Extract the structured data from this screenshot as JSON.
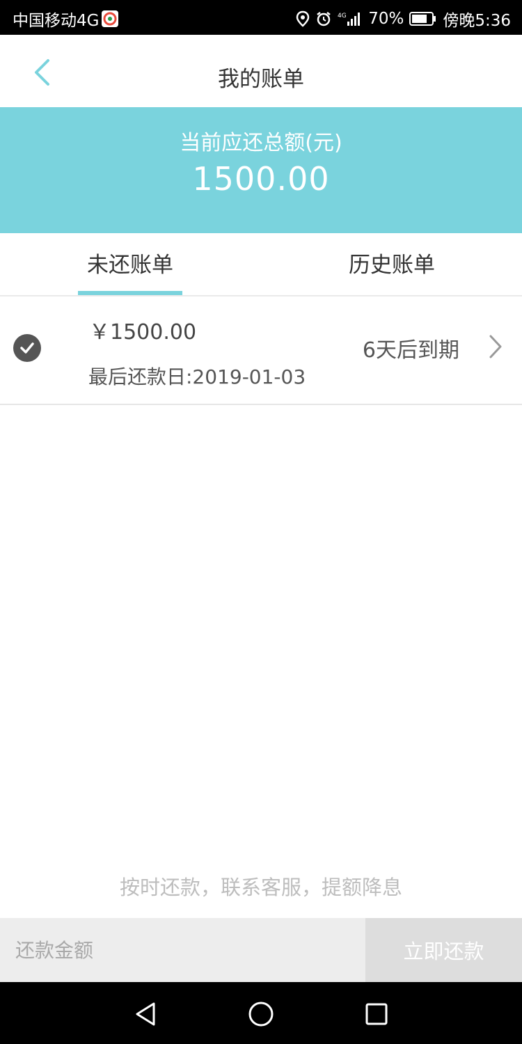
{
  "status_bar": {
    "carrier": "中国移动4G",
    "network": "4G",
    "battery": "70%",
    "time": "傍晚5:36"
  },
  "header": {
    "title": "我的账单"
  },
  "summary": {
    "label": "当前应还总额(元)",
    "amount": "1500.00"
  },
  "tabs": [
    {
      "label": "未还账单",
      "active": true
    },
    {
      "label": "历史账单",
      "active": false
    }
  ],
  "bills": [
    {
      "amount": "￥1500.00",
      "last_repay_date": "最后还款日:2019-01-03",
      "due_text": "6天后到期",
      "selected": true
    }
  ],
  "hint": "按时还款，联系客服，提额降息",
  "action_bar": {
    "amount_placeholder": "还款金额",
    "pay_label": "立即还款"
  },
  "colors": {
    "accent": "#7ad3dd",
    "check": "#555555",
    "disabled_button": "#dddddd"
  },
  "icons": {
    "back": "chevron-left-icon",
    "check": "check-circle-icon",
    "row_arrow": "chevron-right-icon",
    "sys_back": "triangle-back-icon",
    "sys_home": "circle-home-icon",
    "sys_recent": "square-recent-icon"
  }
}
